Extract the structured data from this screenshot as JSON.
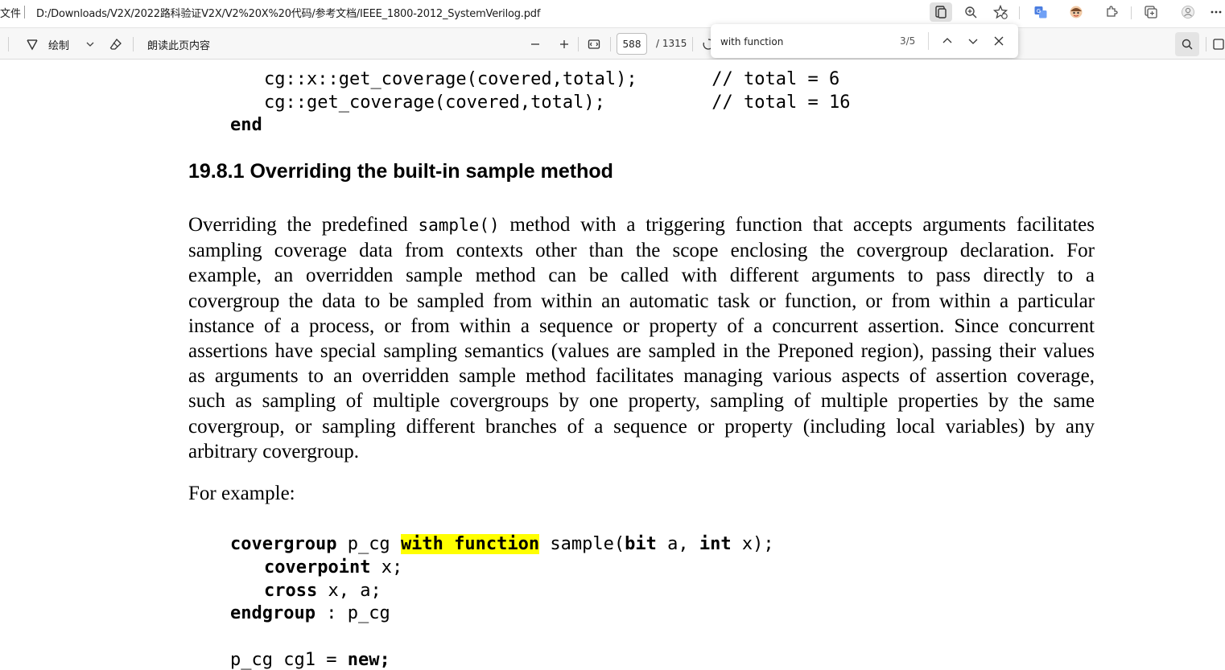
{
  "addressbar": {
    "prefix": "文件",
    "url": "D:/Downloads/V2X/2022路科验证V2X/V2%20X%20代码/参考文档/IEEE_1800-2012_SystemVerilog.pdf"
  },
  "toolbar": {
    "draw_label": "绘制",
    "read_aloud_label": "朗读此页内容",
    "page_current": "588",
    "page_total": "/ 1315"
  },
  "findbar": {
    "query": "with function",
    "count": "3/5"
  },
  "code_top": {
    "line1": "cg::x::get_coverage(covered,total);       // total = 6",
    "line2": "cg::get_coverage(covered,total);          // total = 16",
    "line3": "end"
  },
  "section": {
    "heading": "19.8.1 Overriding the built-in sample method",
    "para_lines": [
      [
        "Overriding the predefined ",
        "sample()",
        " method with a triggering function that accepts arguments facilitates"
      ],
      "sampling coverage data from contexts other than the scope enclosing the covergroup declaration. For",
      "example, an overridden sample method can be called with different arguments to pass directly to a",
      "covergroup the data to be sampled from within an automatic task or function, or from within a particular",
      "instance of a process, or from within a sequence or property of a concurrent assertion. Since concurrent",
      "assertions have special sampling semantics (values are sampled in the Preponed region), passing their values",
      "as arguments to an overridden sample method facilitates managing various aspects of assertion coverage,",
      "such as sampling of multiple covergroups by one property, sampling of multiple properties by the same",
      "covergroup, or sampling different branches of a sequence or property (including local variables) by any",
      "arbitrary covergroup."
    ],
    "example_label": "For example:"
  },
  "code_example": {
    "l1_kw": "covergroup",
    "l1_name": " p_cg ",
    "l1_highlight": "with function",
    "l1_rest_a": " sample(",
    "l1_bit": "bit",
    "l1_rest_b": " a, ",
    "l1_int": "int",
    "l1_rest_c": " x);",
    "l2_kw": "coverpoint",
    "l2_rest": " x;",
    "l3_kw": "cross",
    "l3_rest": " x, a;",
    "l4_kw": "endgroup",
    "l4_rest": " : p_cg",
    "l5_start": "p_cg cg1 = ",
    "l5_kw": "new",
    "l5_end": ";"
  },
  "colors": {
    "highlight": "#ffff00",
    "toolbar_bg": "#f7f7f7"
  }
}
